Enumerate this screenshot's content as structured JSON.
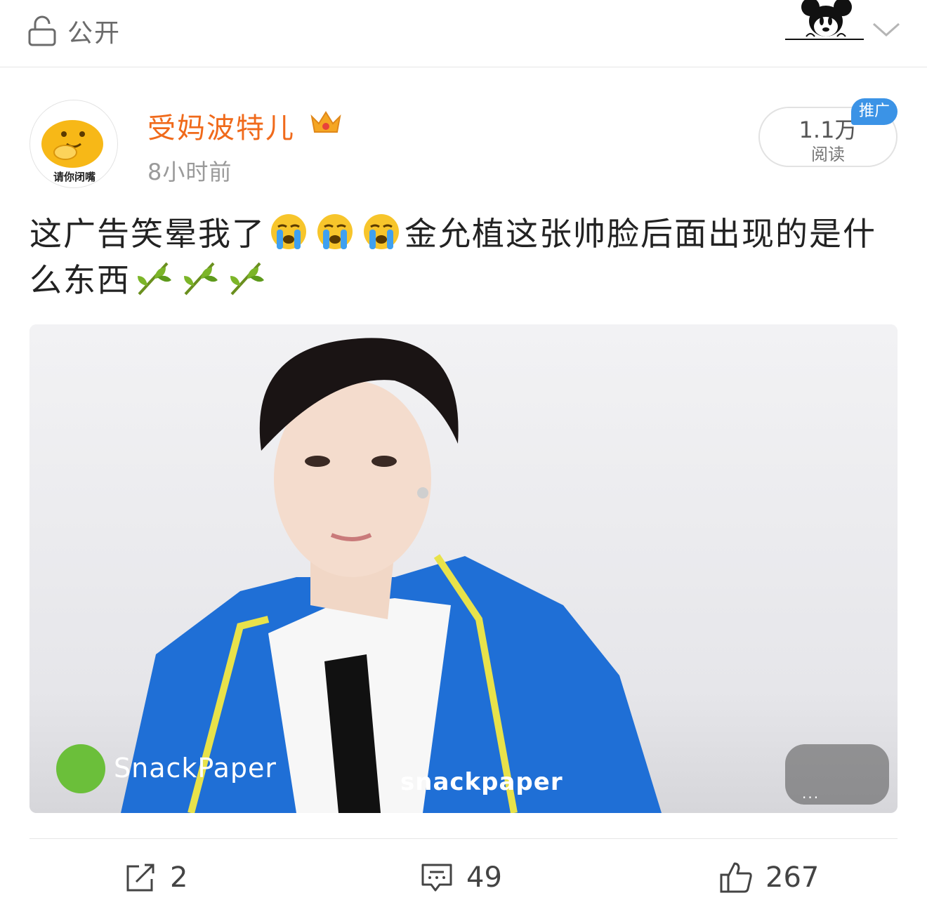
{
  "topbar": {
    "privacy_icon": "lock-icon",
    "privacy_label": "公开",
    "mascot_icon": "mickey-mascot-icon",
    "menu_icon": "chevron-down-icon"
  },
  "post": {
    "author": {
      "name": "受妈波特儿",
      "avatar_caption": "请你闭嘴",
      "badge_icon": "crown-icon"
    },
    "time": "8小时前",
    "reads": {
      "count": "1.1万",
      "label": "阅读"
    },
    "promo_badge": "推广",
    "text": {
      "part1": "这广告笑晕我了",
      "emoji1": "crying-face-emoji",
      "part2": "金允植这张帅脸后面出现的是什么东西",
      "emoji2": "leaf-emoji"
    },
    "media": {
      "watermark_brand": "SnackPaper",
      "watermark_center": "snackpaper",
      "watermark_corner_dots": "..."
    }
  },
  "actions": {
    "repost": {
      "icon": "share-icon",
      "count": "2"
    },
    "comment": {
      "icon": "comment-icon",
      "count": "49"
    },
    "like": {
      "icon": "thumbs-up-icon",
      "count": "267"
    }
  },
  "colors": {
    "username": "#f06a1b",
    "promo_badge": "#3b93e6",
    "muted_text": "#9a9a9a"
  }
}
